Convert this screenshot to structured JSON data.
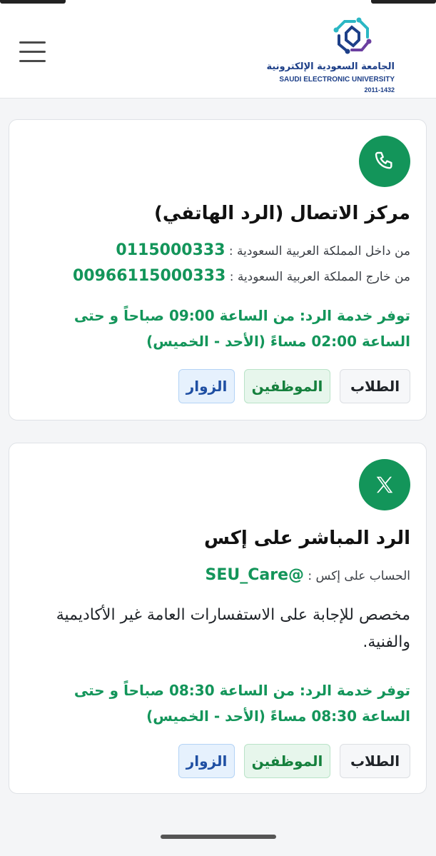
{
  "header": {
    "logo_ar": "الجامعة السعودية الإلكترونية",
    "logo_en": "SAUDI ELECTRONIC UNIVERSITY",
    "logo_years": "2011-1432",
    "menu_icon": "hamburger-menu-icon"
  },
  "colors": {
    "accent_green": "#13955a",
    "brand_blue": "#1d3f88",
    "brand_cyan": "#2bb7c4",
    "brand_purple": "#6b3fa0"
  },
  "cards": [
    {
      "icon": "phone-icon",
      "title": "مركز الاتصال (الرد الهاتفي)",
      "inside_label": "من داخل المملكة العربية السعودية :",
      "inside_value": "0115000333",
      "outside_label": "من خارج المملكة العربية السعودية :",
      "outside_value": "00966115000333",
      "availability": "توفر خدمة الرد: من الساعة 09:00 صباحاً و حتى الساعة 02:00 مساءً (الأحد - الخميس)",
      "tags": [
        "الطلاب",
        "الموظفين",
        "الزوار"
      ]
    },
    {
      "icon": "x-logo-icon",
      "title": "الرد المباشر على إكس",
      "account_label": "الحساب على إكس :",
      "account_value": "@SEU_Care",
      "description": "مخصص للإجابة على الاستفسارات العامة غير الأكاديمية والفنية.",
      "availability": "توفر خدمة الرد: من الساعة 08:30 صباحاً و حتى الساعة 08:30 مساءً (الأحد - الخميس)",
      "tags": [
        "الطلاب",
        "الموظفين",
        "الزوار"
      ]
    }
  ]
}
